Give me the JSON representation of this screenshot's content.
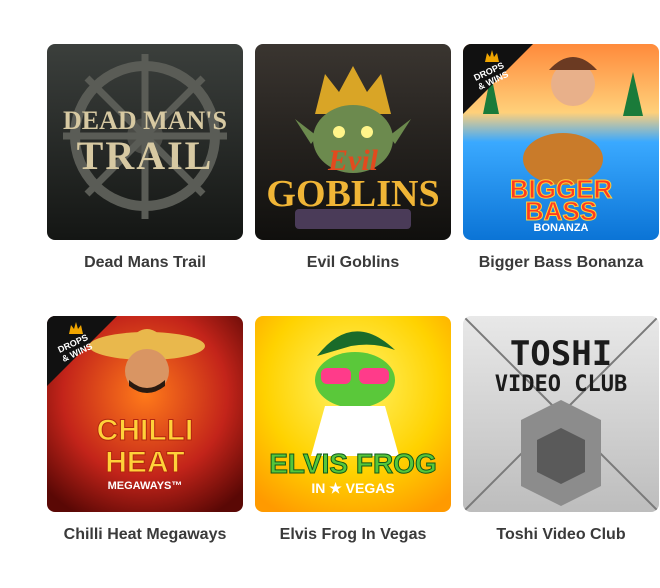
{
  "games": [
    {
      "title": "Dead Mans Trail",
      "art_line1": "DEAD MAN'S",
      "art_line2": "TRAIL",
      "theme": {
        "bg_top": "#3b3f3c",
        "bg_bottom": "#141614",
        "text": "#d7c9a2"
      }
    },
    {
      "title": "Evil Goblins",
      "art_line1": "Evil",
      "art_line2": "GOBLINS",
      "theme": {
        "bg_top": "#2c2a26",
        "bg_bottom": "#100f0d",
        "text": "#f0b536"
      }
    },
    {
      "title": "Bigger Bass Bonanza",
      "art_line1": "BIGGER",
      "art_line2": "BASS",
      "art_line3": "BONANZA",
      "badge": "DROPS & WINS",
      "theme": {
        "bg_top": "#3aa9ff",
        "bg_bottom": "#0b74d6",
        "text": "#ff3b1f"
      }
    },
    {
      "title": "Chilli Heat Megaways",
      "art_line1": "CHILLI",
      "art_line2": "HEAT",
      "art_line3": "MEGAWAYS™",
      "badge": "DROPS & WINS",
      "theme": {
        "bg_top": "#c3241a",
        "bg_bottom": "#7b0c07",
        "text": "#ffd23a"
      }
    },
    {
      "title": "Elvis Frog In Vegas",
      "art_line1": "ELVIS FROG",
      "art_line2": "IN ★ VEGAS",
      "theme": {
        "bg_top": "#ffe100",
        "bg_bottom": "#ff9a00",
        "text": "#55c63a"
      }
    },
    {
      "title": "Toshi Video Club",
      "art_line1": "TOSHI",
      "art_line2": "VIDEO CLUB",
      "theme": {
        "bg_top": "#e8e8e8",
        "bg_bottom": "#bdbdbd",
        "text": "#1b1b1b"
      }
    }
  ]
}
